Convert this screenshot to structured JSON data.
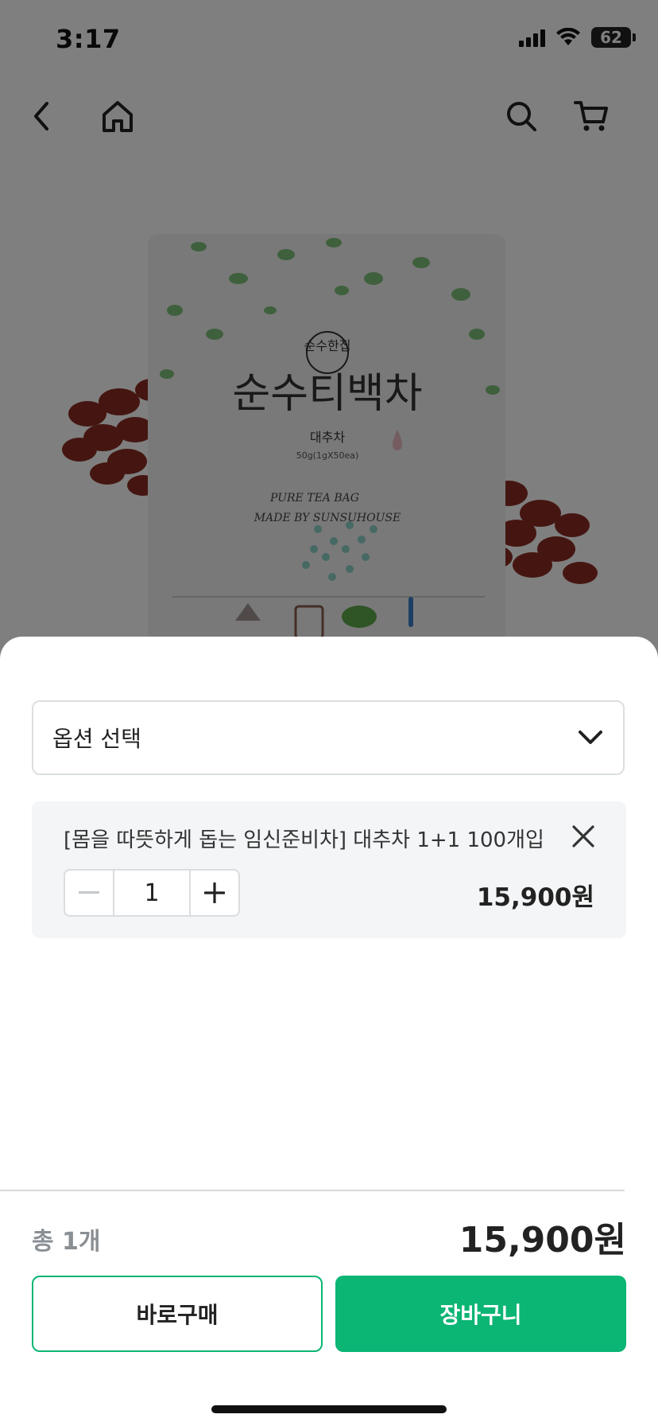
{
  "status_bar": {
    "time": "3:17",
    "battery": "62"
  },
  "top_nav": {
    "icons": [
      "back-chevron-icon",
      "home-icon",
      "search-icon",
      "cart-icon"
    ]
  },
  "product_image": {
    "package_brand": "순수한집",
    "package_title": "순수티백차",
    "package_subtitle": "대추차",
    "package_weight": "50g(1gX50ea)",
    "package_tagline_1": "PURE TEA BAG",
    "package_tagline_2": "MADE BY SUNSUHOUSE"
  },
  "sheet": {
    "option_select": {
      "label": "옵션 선택",
      "icon": "chevron-down-icon"
    },
    "selected_item": {
      "name": "[몸을 따뜻하게 돕는 임신준비차] 대추차 1+1 100개입",
      "quantity": "1",
      "price": "15,900원"
    },
    "total": {
      "label": "총 1개",
      "price": "15,900원"
    },
    "buttons": {
      "buy_now": "바로구매",
      "add_to_cart": "장바구니"
    }
  },
  "colors": {
    "accent": "#0bb574",
    "overlay": "rgba(0,0,0,0.5)"
  }
}
